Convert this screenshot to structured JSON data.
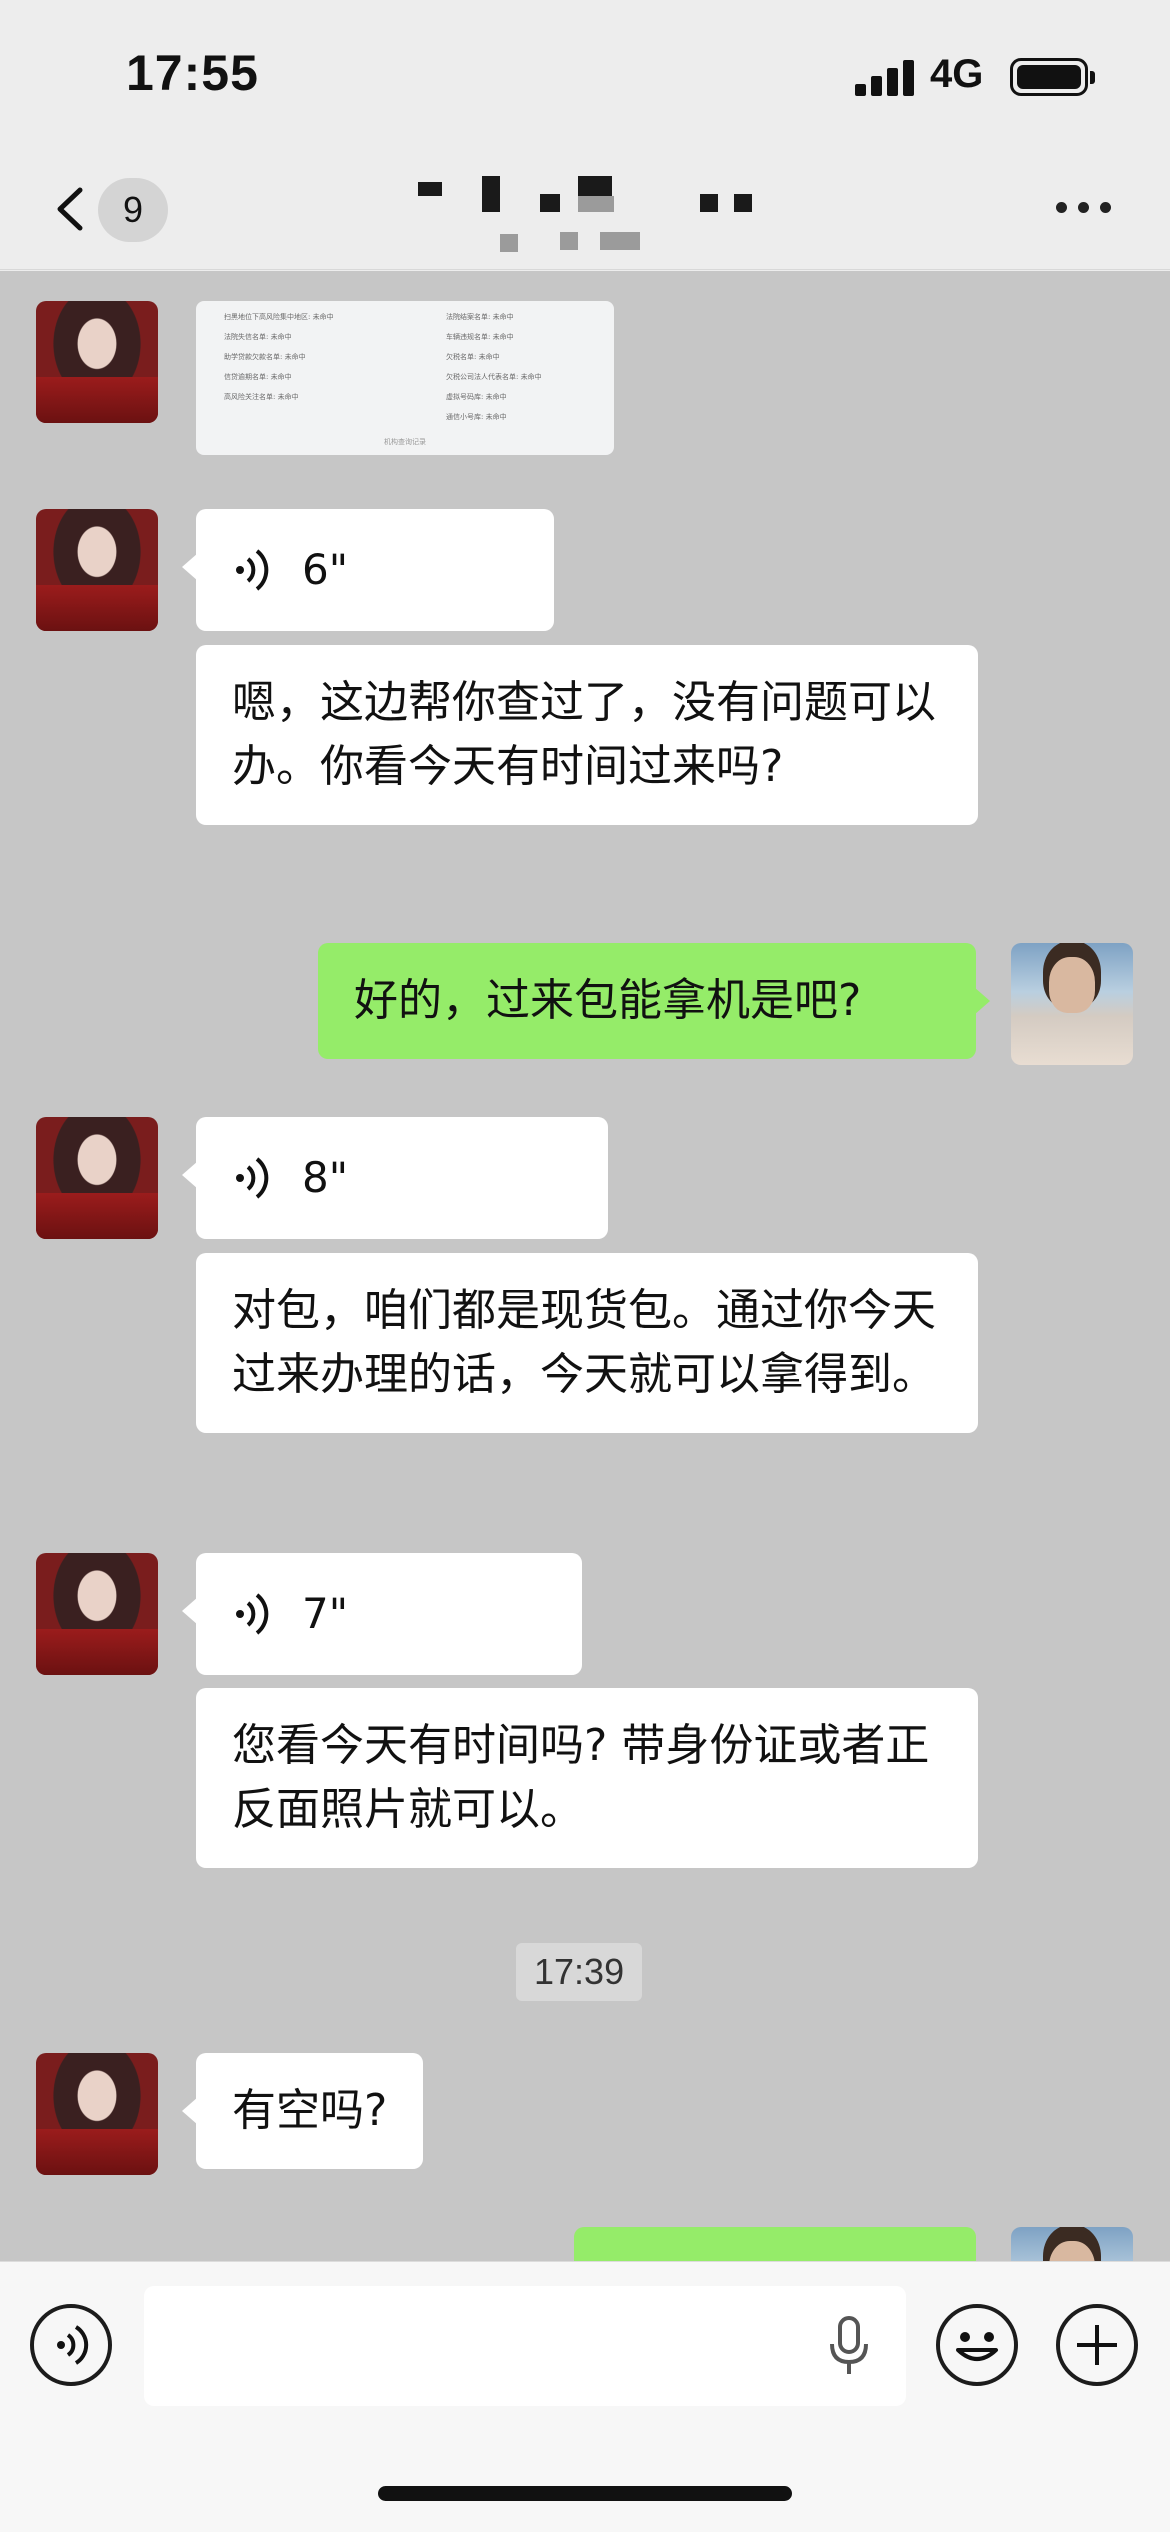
{
  "status_bar": {
    "time": "17:55",
    "network": "4G"
  },
  "nav": {
    "unread_count": "9"
  },
  "image_message": {
    "left_rows": [
      "扫黑地位下高风险集中地区: 未命中",
      "法院失信名单: 未命中",
      "助学贷款欠款名单: 未命中",
      "信贷逾期名单: 未命中",
      "高风险关注名单: 未命中"
    ],
    "right_rows": [
      "法院结案名单: 未命中",
      "车辆违规名单: 未命中",
      "欠税名单: 未命中",
      "欠税公司法人代表名单: 未命中",
      "虚拟号码库: 未命中",
      "通信小号库: 未命中"
    ],
    "footer": "机构查询记录"
  },
  "messages": {
    "voice1": "6\"",
    "text1": "嗯，这边帮你查过了，没有问题可以办。你看今天有时间过来吗?",
    "out1": "好的，过来包能拿机是吧?",
    "voice2": "8\"",
    "text2": "对包，咱们都是现货包。通过你今天过来办理的话，今天就可以拿得到。",
    "voice3": "7\"",
    "text3": "您看今天有时间吗? 带身份证或者正反面照片就可以。",
    "timestamp": "17:39",
    "text4": "有空吗?"
  },
  "input": {
    "placeholder": ""
  },
  "colors": {
    "outgoing_bubble": "#95ec69",
    "incoming_bubble": "#ffffff",
    "chat_background": "#c6c6c6"
  },
  "icons": [
    "back-chevron-icon",
    "more-icon",
    "voice-wave-icon",
    "voice-input-icon",
    "microphone-icon",
    "emoji-icon",
    "plus-icon"
  ]
}
